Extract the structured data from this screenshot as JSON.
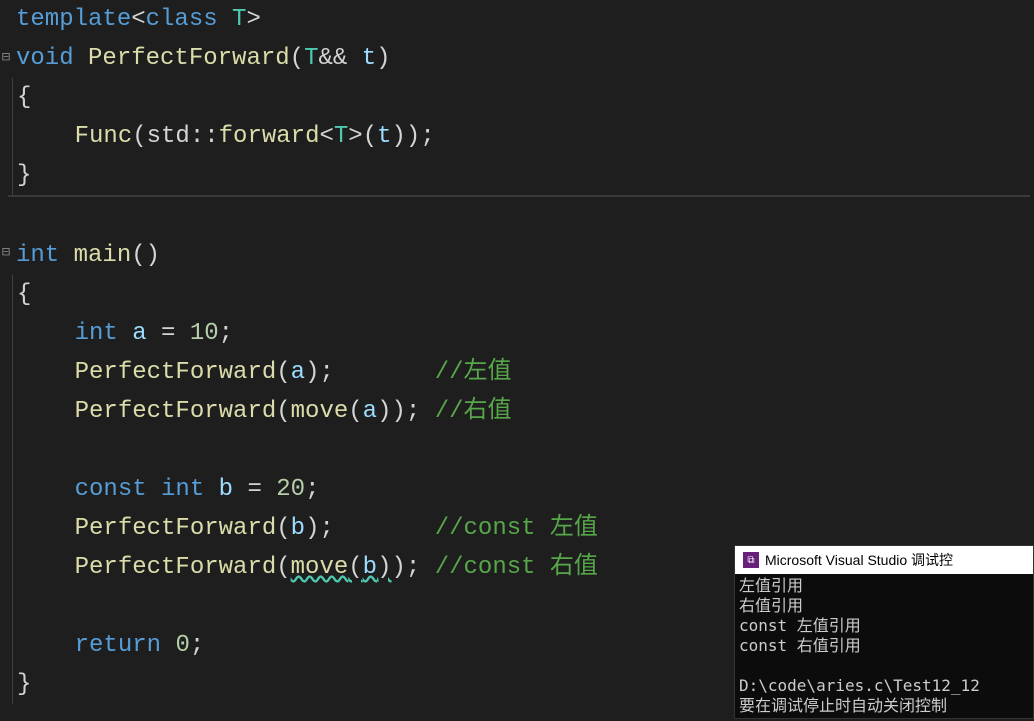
{
  "code": {
    "line1": {
      "template": "template",
      "angle1": "<",
      "class": "class",
      "T": "T",
      "angle2": ">"
    },
    "line2": {
      "void": "void",
      "fn": "PerfectForward",
      "p1": "(",
      "T": "T",
      "amp": "&&",
      "sp": " ",
      "t": "t",
      "p2": ")"
    },
    "line3": {
      "brace": "{"
    },
    "line4": {
      "indent": "    ",
      "fn": "Func",
      "p1": "(",
      "std": "std",
      "ns": "::",
      "fwd": "forward",
      "a1": "<",
      "T": "T",
      "a2": ">",
      "p2": "(",
      "t": "t",
      "p3": ")",
      "p4": ")",
      "semi": ";"
    },
    "line5": {
      "brace": "}"
    },
    "line6": "",
    "line7": {
      "int": "int",
      "main": "main",
      "p": "()"
    },
    "line8": {
      "brace": "{"
    },
    "line9": {
      "indent": "    ",
      "int": "int",
      "a": "a",
      "eq": " = ",
      "num": "10",
      "semi": ";"
    },
    "line10": {
      "indent": "    ",
      "fn": "PerfectForward",
      "p1": "(",
      "a": "a",
      "p2": ")",
      "semi": ";",
      "pad": "       ",
      "comment": "//左值"
    },
    "line11": {
      "indent": "    ",
      "fn": "PerfectForward",
      "p1": "(",
      "move": "move",
      "p2": "(",
      "a": "a",
      "p3": ")",
      "p4": ")",
      "semi": ";",
      "sp": " ",
      "comment": "//右值"
    },
    "line12": "",
    "line13": {
      "indent": "    ",
      "const": "const",
      "int": "int",
      "b": "b",
      "eq": " = ",
      "num": "20",
      "semi": ";"
    },
    "line14": {
      "indent": "    ",
      "fn": "PerfectForward",
      "p1": "(",
      "b": "b",
      "p2": ")",
      "semi": ";",
      "pad": "       ",
      "comment": "//const 左值"
    },
    "line15": {
      "indent": "    ",
      "fn": "PerfectForward",
      "p1": "(",
      "move": "move",
      "p2": "(",
      "b": "b",
      "p3": ")",
      "p4": ")",
      "semi": ";",
      "sp": " ",
      "comment": "//const 右值"
    },
    "line16": "",
    "line17": {
      "indent": "    ",
      "return": "return",
      "num": "0",
      "semi": ";"
    },
    "line18": {
      "brace": "}"
    }
  },
  "fold": {
    "minus": "⊟"
  },
  "console": {
    "title": "Microsoft Visual Studio 调试控",
    "l1": "左值引用",
    "l2": "右值引用",
    "l3": "const 左值引用",
    "l4": "const 右值引用",
    "l5": "",
    "l6": "D:\\code\\aries.c\\Test12_12",
    "l7": "要在调试停止时自动关闭控制"
  }
}
